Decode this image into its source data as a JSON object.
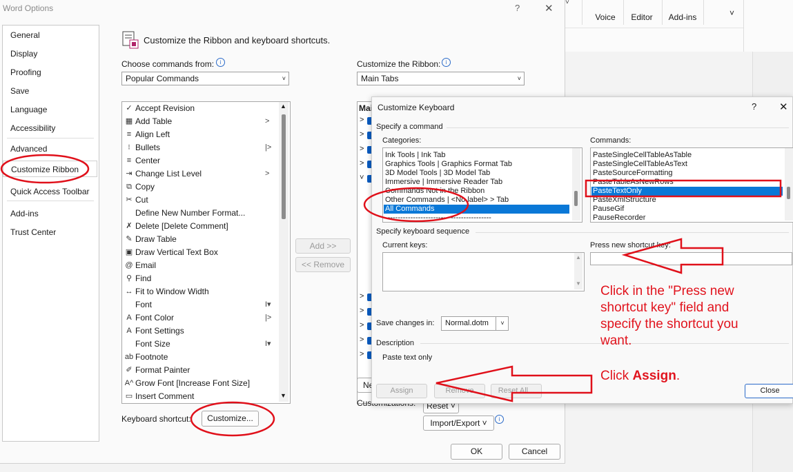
{
  "word_options": {
    "title": "Word Options",
    "help": "?",
    "close": "✕",
    "nav": [
      {
        "label": "General"
      },
      {
        "label": "Display"
      },
      {
        "label": "Proofing"
      },
      {
        "label": "Save"
      },
      {
        "label": "Language"
      },
      {
        "label": "Accessibility"
      },
      {
        "label": "Advanced"
      },
      {
        "label": "Customize Ribbon"
      },
      {
        "label": "Quick Access Toolbar"
      },
      {
        "label": "Add-ins"
      },
      {
        "label": "Trust Center"
      }
    ],
    "heading": "Customize the Ribbon and keyboard shortcuts.",
    "choose_label": "Choose commands from:",
    "choose_value": "Popular Commands",
    "customize_ribbon_label": "Customize the Ribbon:",
    "customize_ribbon_value": "Main Tabs",
    "commands": [
      {
        "label": "Accept Revision",
        "icon": "✓",
        "sub": ""
      },
      {
        "label": "Add Table",
        "icon": "▦",
        "sub": ">"
      },
      {
        "label": "Align Left",
        "icon": "≡",
        "sub": ""
      },
      {
        "label": "Bullets",
        "icon": "⁝",
        "sub": "|>"
      },
      {
        "label": "Center",
        "icon": "≡",
        "sub": ""
      },
      {
        "label": "Change List Level",
        "icon": "⇥",
        "sub": ">"
      },
      {
        "label": "Copy",
        "icon": "⧉",
        "sub": ""
      },
      {
        "label": "Cut",
        "icon": "✂",
        "sub": ""
      },
      {
        "label": "Define New Number Format...",
        "icon": "",
        "sub": ""
      },
      {
        "label": "Delete [Delete Comment]",
        "icon": "✗",
        "sub": ""
      },
      {
        "label": "Draw Table",
        "icon": "✎",
        "sub": ""
      },
      {
        "label": "Draw Vertical Text Box",
        "icon": "▣",
        "sub": ""
      },
      {
        "label": "Email",
        "icon": "@",
        "sub": ""
      },
      {
        "label": "Find",
        "icon": "⚲",
        "sub": ""
      },
      {
        "label": "Fit to Window Width",
        "icon": "↔",
        "sub": ""
      },
      {
        "label": "Font",
        "icon": "",
        "sub": "I▾"
      },
      {
        "label": "Font Color",
        "icon": "A",
        "sub": "|>"
      },
      {
        "label": "Font Settings",
        "icon": "A",
        "sub": ""
      },
      {
        "label": "Font Size",
        "icon": "",
        "sub": "I▾"
      },
      {
        "label": "Footnote",
        "icon": "ab",
        "sub": ""
      },
      {
        "label": "Format Painter",
        "icon": "✐",
        "sub": ""
      },
      {
        "label": "Grow Font [Increase Font Size]",
        "icon": "A^",
        "sub": ""
      },
      {
        "label": "Insert Comment",
        "icon": "▭",
        "sub": ""
      }
    ],
    "add_btn": "Add >>",
    "remove_btn": "<< Remove",
    "keyboard_shortcut_label": "Keyboard shortcut:",
    "customize_btn": "Customize...",
    "customizations_label": "Customizations:",
    "reset_btn": "Reset ˅",
    "import_export_btn": "Import/Export ˅",
    "new_btn": "Ne",
    "ok_btn": "OK",
    "cancel_btn": "Cancel",
    "tree_header": "Mai"
  },
  "ribbon_bg": {
    "voice": "Voice",
    "editor": "Editor",
    "addins": "Add-ins"
  },
  "customize_keyboard": {
    "title": "Customize Keyboard",
    "help": "?",
    "close": "✕",
    "specify_command": "Specify a command",
    "categories_label": "Categories:",
    "categories": [
      "Ink Tools | Ink Tab",
      "Graphics Tools | Graphics Format Tab",
      "3D Model Tools | 3D Model Tab",
      "Immersive | Immersive Reader Tab",
      "Commands Not in the Ribbon",
      "Other Commands | <No label> > Tab",
      "All Commands",
      "------------------------------------------"
    ],
    "commands_label": "Commands:",
    "commands": [
      "PasteSingleCellTableAsTable",
      "PasteSingleCellTableAsText",
      "PasteSourceFormatting",
      "PasteTableAsNewRows",
      "PasteTextOnly",
      "PasteXmlStructure",
      "PauseGif",
      "PauseRecorder"
    ],
    "specify_sequence": "Specify keyboard sequence",
    "current_keys_label": "Current keys:",
    "press_new_label": "Press new shortcut key:",
    "save_changes_label": "Save changes in:",
    "save_changes_value": "Normal.dotm",
    "description_label": "Description",
    "description_text": "Paste text only",
    "assign_btn": "Assign",
    "remove_btn": "Remove",
    "reset_all_btn": "Reset All...",
    "close_btn": "Close"
  },
  "annotations": {
    "instr1": "Click in the \"Press new shortcut key\" field and specify the shortcut you want.",
    "instr2_prefix": "Click ",
    "instr2_bold": "Assign",
    "instr2_suffix": "."
  }
}
